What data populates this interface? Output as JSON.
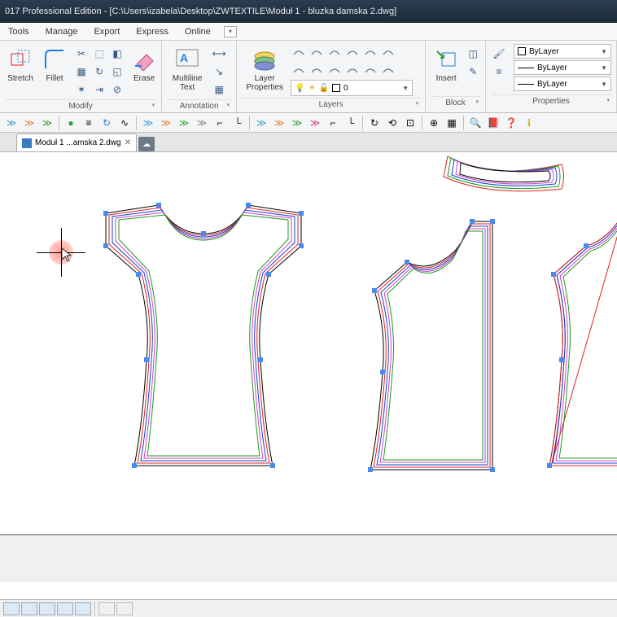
{
  "title": "017 Professional Edition - [C:\\Users\\izabela\\Desktop\\ZWTEXTILE\\Moduł 1 - bluzka damska 2.dwg]",
  "menu": {
    "tools": "Tools",
    "manage": "Manage",
    "export": "Export",
    "express": "Express",
    "online": "Online"
  },
  "ribbon": {
    "modify": {
      "label": "Modify",
      "stretch": "Stretch",
      "fillet": "Fillet",
      "erase": "Erase"
    },
    "annotation": {
      "label": "Annotation",
      "multiline": "Multiline\nText"
    },
    "layers": {
      "label": "Layers",
      "layerprops": "Layer\nProperties",
      "current": "0"
    },
    "block": {
      "label": "Block",
      "insert": "Insert"
    },
    "properties": {
      "label": "Properties",
      "bylayer": "ByLayer"
    }
  },
  "tab": {
    "name": "Moduł 1 ...amska 2.dwg"
  },
  "colors": {
    "pattern_strokes": [
      "#e02020",
      "#1a9a1a",
      "#1040d0",
      "#d040d0",
      "#000000"
    ]
  }
}
